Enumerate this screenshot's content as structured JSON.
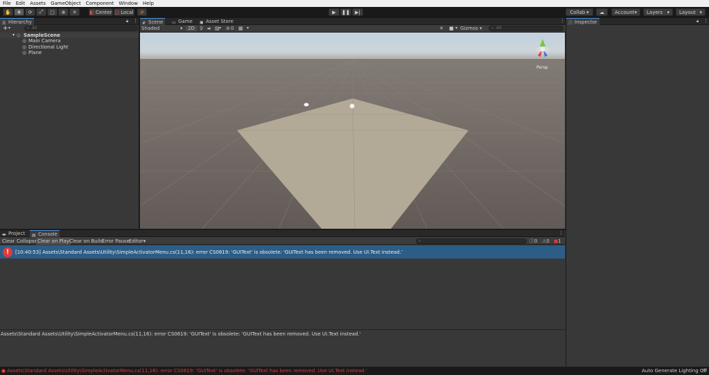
{
  "menu": [
    "File",
    "Edit",
    "Assets",
    "GameObject",
    "Component",
    "Window",
    "Help"
  ],
  "toolbar": {
    "tools": [
      "hand-tool",
      "move-tool",
      "rotate-tool",
      "scale-tool",
      "rect-tool",
      "transform-tool",
      "custom-tool"
    ],
    "pivot": "Center",
    "space": "Local",
    "collab": "Collab",
    "account": "Account",
    "layers": "Layers",
    "layout": "Layout"
  },
  "hierarchy": {
    "tab": "Hierarchy",
    "add": "+",
    "search_placeholder": "All",
    "scene": "SampleScene",
    "items": [
      "Main Camera",
      "Directional Light",
      "Plane"
    ]
  },
  "scene_tabs": [
    "Scene",
    "Game",
    "Asset Store"
  ],
  "scene_toolbar": {
    "shading": "Shaded",
    "mode2d": "2D",
    "hidden_count": "0",
    "gizmos": "Gizmos",
    "search_placeholder": "All"
  },
  "gizmo": {
    "axes": [
      "y",
      "x",
      "z"
    ],
    "label": "Persp"
  },
  "inspector": {
    "tab": "Inspector"
  },
  "console": {
    "tabs": [
      "Project",
      "Console"
    ],
    "buttons": [
      "Clear",
      "Collapse",
      "Clear on Play",
      "Clear on Build",
      "Error Pause",
      "Editor"
    ],
    "counts": {
      "log": "0",
      "warning": "0",
      "error": "1"
    },
    "error_message": "[10:40:53] Assets\\Standard Assets\\Utility\\SimpleActivatorMenu.cs(11,16): error CS0619: 'GUIText' is obsolete: 'GUIText has been removed. Use UI.Text instead.'",
    "detail": "Assets\\Standard Assets\\Utility\\SimpleActivatorMenu.cs(11,16): error CS0619: 'GUIText' is obsolete: 'GUIText has been removed. Use UI.Text instead.'"
  },
  "statusbar": {
    "message": "Assets\\Standard Assets\\Utility\\SimpleActivatorMenu.cs(11,16): error CS0619: 'GUIText' is obsolete: 'GUIText has been removed. Use UI.Text instead.'",
    "right": "Auto Generate Lighting Off"
  },
  "colors": {
    "accent": "#4a8fd9",
    "error": "#e03b3b",
    "selection": "#2c5d87",
    "panel": "#383838"
  }
}
